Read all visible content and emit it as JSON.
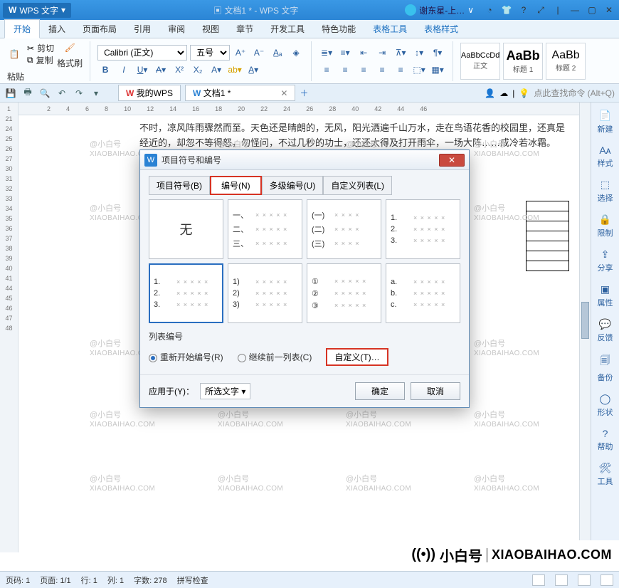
{
  "titlebar": {
    "app": "WPS 文字",
    "doc": "文档1 * - WPS 文字",
    "user": "谢东星-上…"
  },
  "ribbon_tabs": [
    "开始",
    "插入",
    "页面布局",
    "引用",
    "审阅",
    "视图",
    "章节",
    "开发工具",
    "特色功能",
    "表格工具",
    "表格样式"
  ],
  "active_ribbon_tab": "开始",
  "clipboard": {
    "paste": "粘贴",
    "cut": "剪切",
    "copy": "复制",
    "fmtpaint": "格式刷"
  },
  "font": {
    "name": "Calibri (正文)",
    "size": "五号"
  },
  "styles": [
    {
      "preview": "AaBbCcDd",
      "label": "正文"
    },
    {
      "preview": "AaBb",
      "label": "标题 1"
    },
    {
      "preview": "AaBb",
      "label": "标题 2"
    }
  ],
  "qat": {
    "mywps": "我的WPS",
    "doctab": "文档1 *"
  },
  "search_label": "点此查找命令 (Alt+Q)",
  "hruler": [
    "2",
    "4",
    "6",
    "8",
    "10",
    "12",
    "14",
    "16",
    "18",
    "20",
    "22",
    "24",
    "26",
    "28",
    "40",
    "42",
    "44",
    "46"
  ],
  "vruler": [
    "1",
    "21",
    "24",
    "25",
    "26",
    "27",
    "30",
    "31",
    "32",
    "33",
    "34",
    "35",
    "36",
    "37",
    "38",
    "39",
    "40",
    "41",
    "44",
    "45",
    "46",
    "47",
    "48"
  ],
  "doc_text": "不时，凉风阵雨骤然而至。天色还是晴朗的，无风，阳光洒遍千山万水，走在鸟语花香的校园里，还真是经近的，却忽不等得怒，勿怪问，不过几秒的功士，还还太得及打开雨伞，一场大阵……成冷若冰霜。显………入了一场错误的",
  "sidepanel": [
    "新建",
    "样式",
    "选择",
    "限制",
    "分享",
    "属性",
    "反馈",
    "备份",
    "形状",
    "帮助",
    "工具"
  ],
  "statusbar": {
    "page": "页码: 1",
    "pages": "页面: 1/1",
    "line": "行: 1",
    "col": "列: 1",
    "chars": "字数: 278",
    "mode": "拼写检查"
  },
  "dialog": {
    "title": "项目符号和编号",
    "tabs": [
      "项目符号(B)",
      "编号(N)",
      "多级编号(U)",
      "自定义列表(L)"
    ],
    "active_tab": "编号(N)",
    "cells": [
      {
        "type": "none",
        "label": "无"
      },
      {
        "type": "num",
        "labels": [
          "一、",
          "二、",
          "三、"
        ]
      },
      {
        "type": "num",
        "labels": [
          "(一)",
          "(二)",
          "(三)"
        ]
      },
      {
        "type": "num",
        "labels": [
          "1.",
          "2.",
          "3."
        ]
      },
      {
        "type": "num",
        "labels": [
          "1.",
          "2.",
          "3."
        ],
        "sel": true
      },
      {
        "type": "num",
        "labels": [
          "1)",
          "2)",
          "3)"
        ]
      },
      {
        "type": "num",
        "labels": [
          "①",
          "②",
          "③"
        ]
      },
      {
        "type": "num",
        "labels": [
          "a.",
          "b.",
          "c."
        ]
      }
    ],
    "list_cont_label": "列表编号",
    "radios": [
      {
        "label": "重新开始编号(R)",
        "on": true
      },
      {
        "label": "继续前一列表(C)",
        "on": false
      }
    ],
    "custom_btn": "自定义(T)…",
    "apply_to_label": "应用于(Y)：",
    "apply_to_value": "所选文字",
    "ok": "确定",
    "cancel": "取消"
  },
  "brand": {
    "cn": "小白号",
    "domain": "XIAOBAIHAO.COM"
  },
  "watermark": {
    "cn": "@小白号",
    "en": "XIAOBAIHAO.COM"
  },
  "chart_data": null
}
